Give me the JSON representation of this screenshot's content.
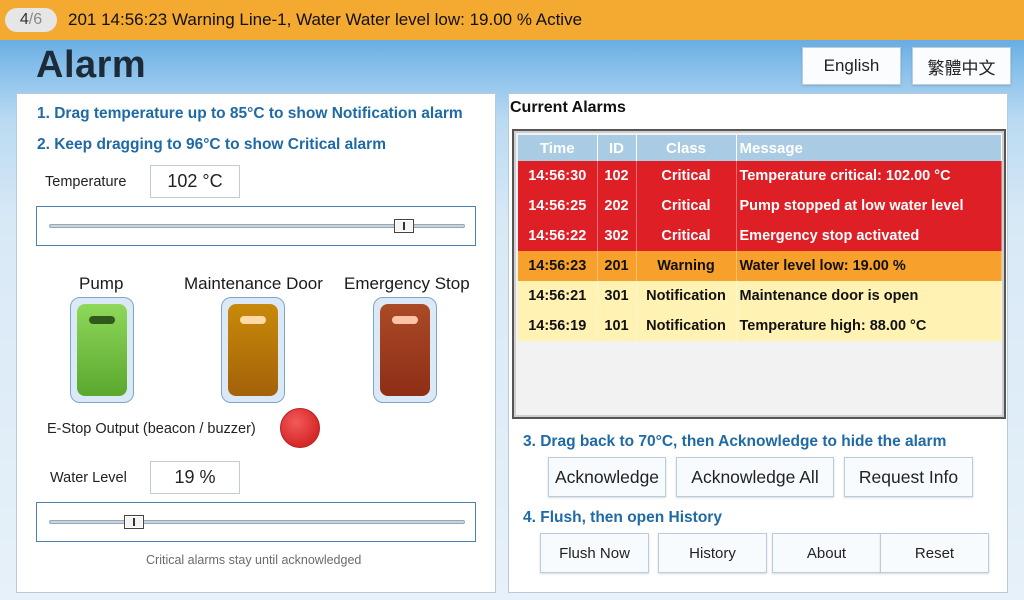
{
  "banner": {
    "page_current": "4",
    "page_total": "/6",
    "message": "201 14:56:23 Warning Line-1, Water Water level low: 19.00 % Active",
    "color": "#f4a930"
  },
  "title": "Alarm",
  "languages": {
    "english": "English",
    "chinese": "繁體中文"
  },
  "left": {
    "step1": "1. Drag temperature up to 85°C to show Notification alarm",
    "step2": "2. Keep dragging to 96°C to show Critical alarm",
    "temperature_label": "Temperature",
    "temperature_value": "102 °C",
    "temperature_slider_fraction": 0.87,
    "devices": [
      {
        "label": "Pump",
        "color": "green"
      },
      {
        "label": "Maintenance Door",
        "color": "amber"
      },
      {
        "label": "Emergency Stop",
        "color": "red"
      }
    ],
    "estop_label": "E-Stop Output (beacon / buzzer)",
    "water_label": "Water Level",
    "water_value": "19 %",
    "water_slider_fraction": 0.19,
    "note": "Critical alarms stay until acknowledged"
  },
  "right": {
    "title": "Current Alarms",
    "columns": [
      "Time",
      "ID",
      "Class",
      "Message"
    ],
    "rows": [
      {
        "time": "14:56:30",
        "id": "102",
        "class": "Critical",
        "message": "Temperature critical: 102.00 °C",
        "level": "critical"
      },
      {
        "time": "14:56:25",
        "id": "202",
        "class": "Critical",
        "message": "Pump stopped at low water level",
        "level": "critical"
      },
      {
        "time": "14:56:22",
        "id": "302",
        "class": "Critical",
        "message": "Emergency stop activated",
        "level": "critical"
      },
      {
        "time": "14:56:23",
        "id": "201",
        "class": "Warning",
        "message": "Water level low: 19.00 %",
        "level": "warning"
      },
      {
        "time": "14:56:21",
        "id": "301",
        "class": "Notification",
        "message": "Maintenance door is open",
        "level": "notification"
      },
      {
        "time": "14:56:19",
        "id": "101",
        "class": "Notification",
        "message": "Temperature high: 88.00 °C",
        "level": "notification"
      }
    ],
    "step3": "3. Drag back to 70°C, then Acknowledge to hide the alarm",
    "buttons_ack": [
      "Acknowledge",
      "Acknowledge All",
      "Request Info"
    ],
    "step4": "4. Flush, then open History",
    "buttons_bottom": [
      "Flush Now",
      "History",
      "About",
      "Reset"
    ]
  }
}
